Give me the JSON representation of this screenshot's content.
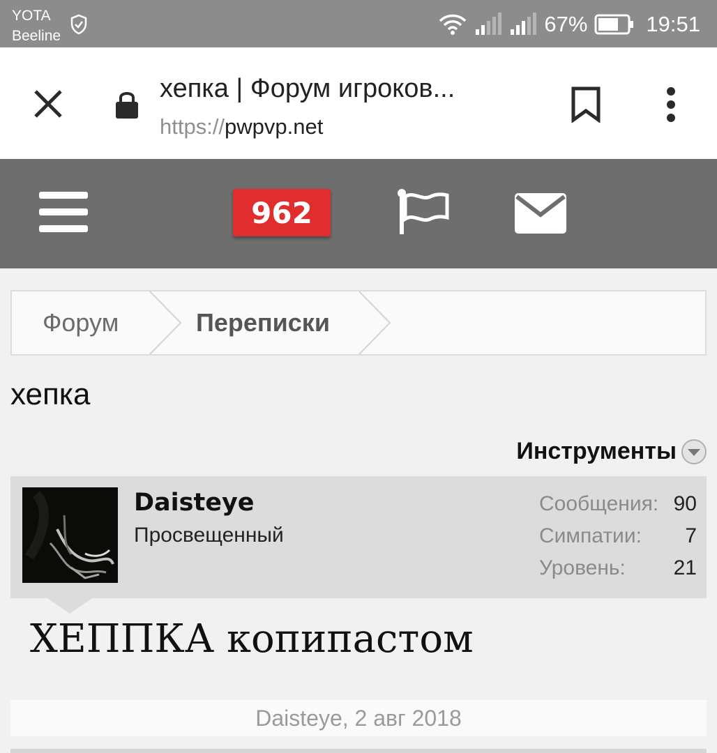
{
  "status_bar": {
    "carrier_1": "YOTA",
    "carrier_2": "Beeline",
    "battery_percent": "67%",
    "time": "19:51",
    "icons": [
      "vpn-shield-icon",
      "wifi-icon",
      "signal-icon",
      "battery-icon"
    ]
  },
  "browser": {
    "page_title": "хепка | Форум игроков...",
    "url_scheme": "https://",
    "url_host": "pwpvp.net",
    "icons": [
      "close-icon",
      "lock-icon",
      "bookmark-icon",
      "more-vert-icon"
    ]
  },
  "forum_nav": {
    "notification_count": "962",
    "icons": [
      "menu-icon",
      "flag-icon",
      "mail-icon"
    ],
    "accent_color": "#e02d2d"
  },
  "breadcrumb": {
    "items": [
      "Форум",
      "Переписки"
    ]
  },
  "thread": {
    "title": "хепка",
    "tools_label": "Инструменты"
  },
  "message": {
    "username": "Daisteye",
    "user_title": "Просвещенный",
    "stats": [
      {
        "label": "Сообщения:",
        "value": "90"
      },
      {
        "label": "Симпатии:",
        "value": "7"
      },
      {
        "label": "Уровень:",
        "value": "21"
      }
    ],
    "heading": "ХЕППКА копипастом",
    "meta": "Daisteye, 2 авг 2018"
  }
}
